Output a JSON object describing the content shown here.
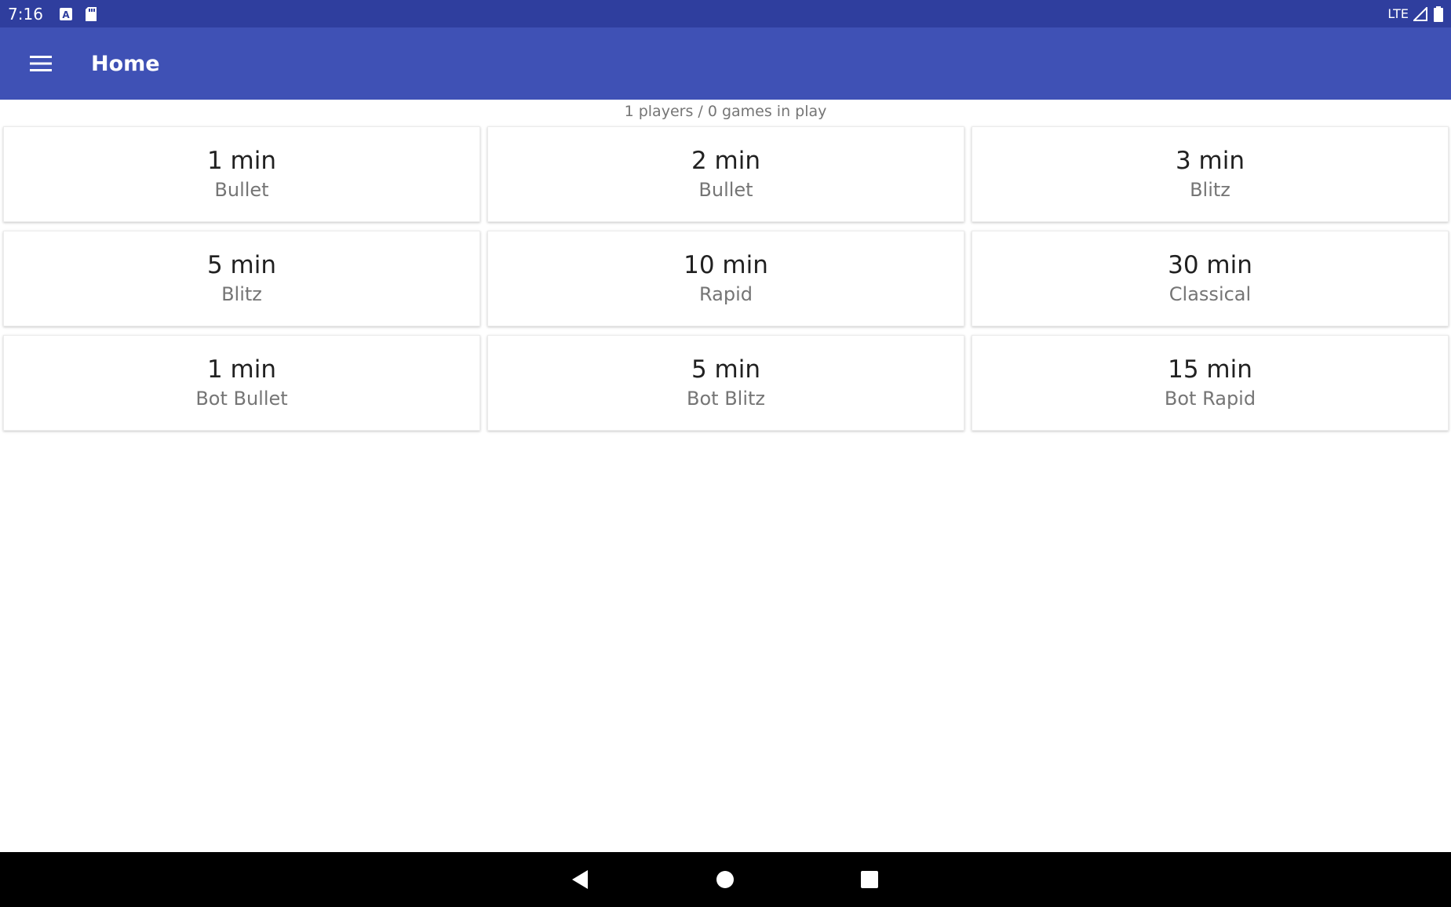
{
  "status_bar": {
    "time": "7:16",
    "network": "LTE",
    "icons": [
      "keyboard-a-icon",
      "sd-card-icon",
      "signal-icon",
      "battery-icon"
    ]
  },
  "app_bar": {
    "title": "Home",
    "menu_icon": "hamburger-menu-icon",
    "background": "#3f51b5"
  },
  "subtitle": "1 players / 0 games in play",
  "tiles": [
    {
      "time": "1 min",
      "type": "Bullet"
    },
    {
      "time": "2 min",
      "type": "Bullet"
    },
    {
      "time": "3 min",
      "type": "Blitz"
    },
    {
      "time": "5 min",
      "type": "Blitz"
    },
    {
      "time": "10 min",
      "type": "Rapid"
    },
    {
      "time": "30 min",
      "type": "Classical"
    },
    {
      "time": "1 min",
      "type": "Bot Bullet"
    },
    {
      "time": "5 min",
      "type": "Bot Blitz"
    },
    {
      "time": "15 min",
      "type": "Bot Rapid"
    }
  ],
  "nav_bar": {
    "icons": [
      "back-icon",
      "home-icon",
      "recents-icon"
    ]
  }
}
